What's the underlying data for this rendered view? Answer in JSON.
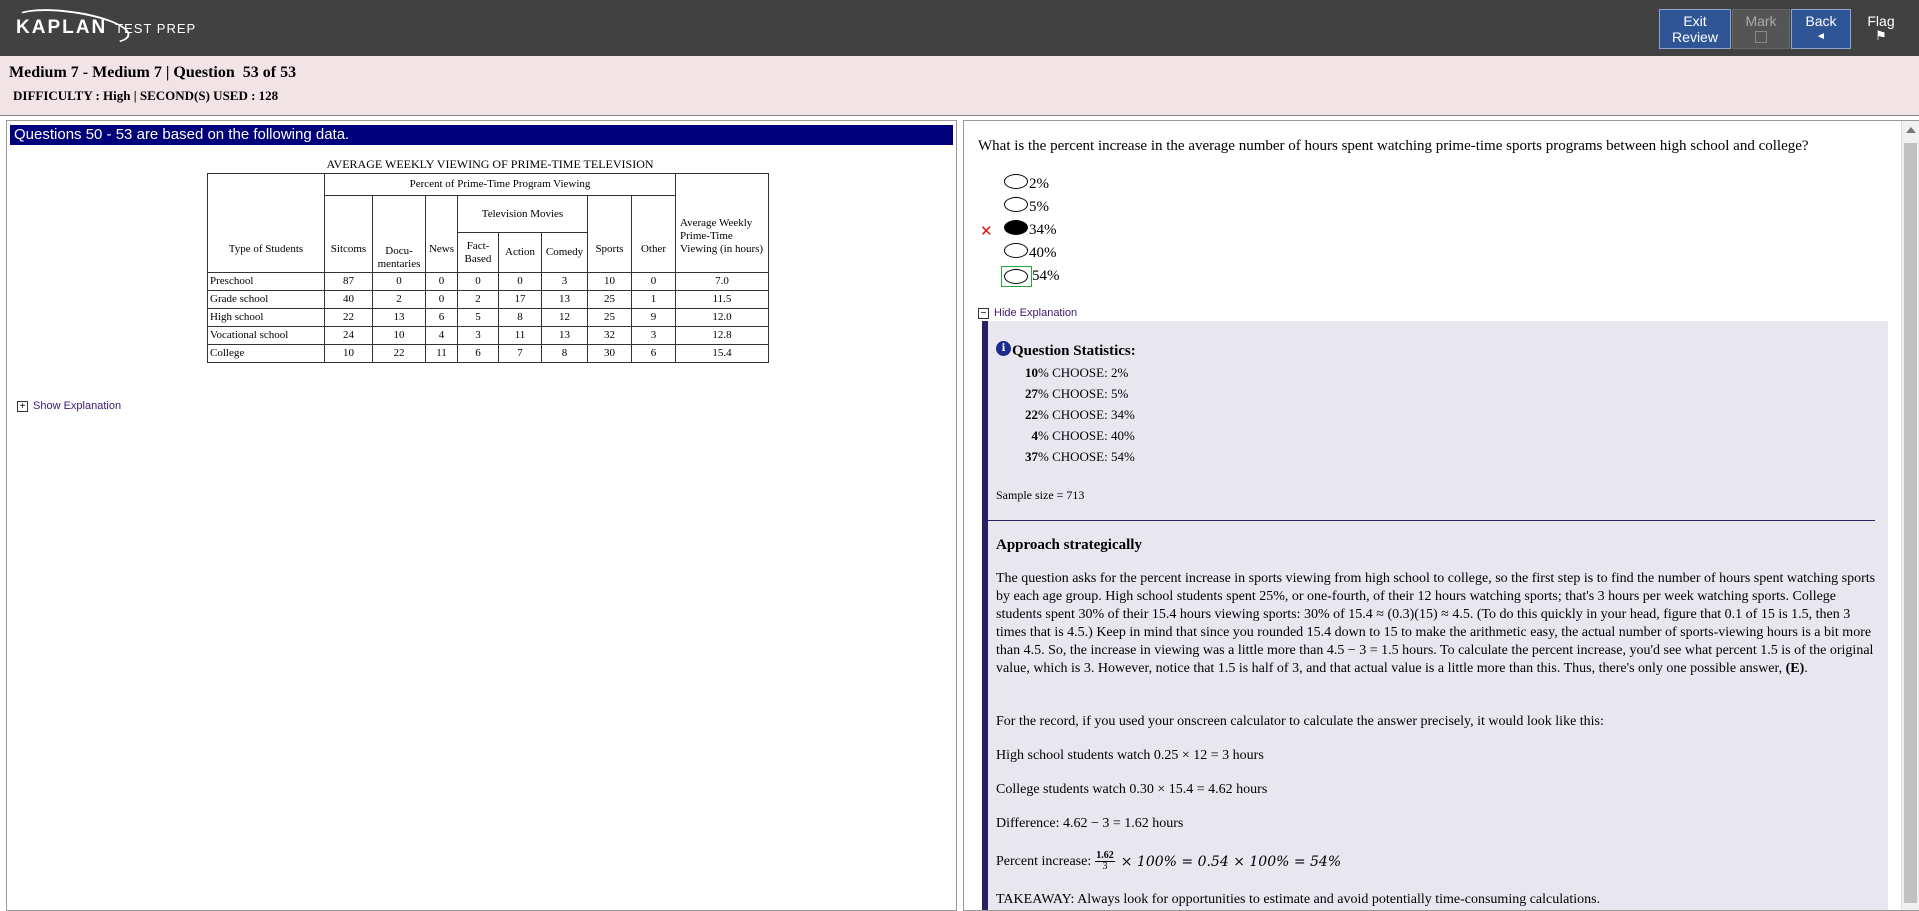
{
  "topbar": {
    "logo_brand": "KAPLAN",
    "logo_sub": "TEST PREP",
    "exit_line1": "Exit",
    "exit_line2": "Review",
    "mark_label": "Mark",
    "back_label": "Back",
    "back_arrow": "◄",
    "flag_label": "Flag",
    "flag_icon": "⚑"
  },
  "header": {
    "title": "Medium 7 - Medium 7 | Question  53 of 53",
    "difficulty": "DIFFICULTY : High | SECOND(S) USED : 128"
  },
  "passage": {
    "banner": "Questions 50 - 53 are based on the following data.",
    "table_title": "AVERAGE WEEKLY VIEWING OF PRIME-TIME TELEVISION",
    "group_header": "Percent of Prime-Time Program Viewing",
    "tv_movies_header": "Television Movies",
    "type_header": "Type of Students",
    "avg_header": "Average Weekly Prime-Time Viewing (in hours)",
    "columns": {
      "sitcoms": "Sitcoms",
      "documentaries": "Docu- mentaries",
      "news": "News",
      "fact_based": "Fact- Based",
      "action": "Action",
      "comedy": "Comedy",
      "sports": "Sports",
      "other": "Other"
    },
    "rows": [
      [
        "Preschool",
        "87",
        "0",
        "0",
        "0",
        "0",
        "3",
        "10",
        "0",
        "7.0"
      ],
      [
        "Grade school",
        "40",
        "2",
        "0",
        "2",
        "17",
        "13",
        "25",
        "1",
        "11.5"
      ],
      [
        "High school",
        "22",
        "13",
        "6",
        "5",
        "8",
        "12",
        "25",
        "9",
        "12.0"
      ],
      [
        "Vocational school",
        "24",
        "10",
        "4",
        "3",
        "11",
        "13",
        "32",
        "3",
        "12.8"
      ],
      [
        "College",
        "10",
        "22",
        "11",
        "6",
        "7",
        "8",
        "30",
        "6",
        "15.4"
      ]
    ],
    "show_explanation": "Show Explanation"
  },
  "question": {
    "text": "What is the percent increase in the average number of hours spent watching prime-time sports programs between high school and college?",
    "choices": [
      "2%",
      "5%",
      "34%",
      "40%",
      "54%"
    ],
    "selected_index": 2,
    "correct_index": 4,
    "wrong_mark": "✕",
    "hide_explanation": "Hide Explanation"
  },
  "explanation": {
    "stats_title": "Question Statistics:",
    "stats": [
      {
        "pct": "10",
        "label": "% CHOOSE: 2%"
      },
      {
        "pct": "27",
        "label": "% CHOOSE: 5%"
      },
      {
        "pct": "22",
        "label": "% CHOOSE: 34%"
      },
      {
        "pct": "4",
        "label": "% CHOOSE: 40%"
      },
      {
        "pct": "37",
        "label": "% CHOOSE: 54%"
      }
    ],
    "sample_size": "Sample size = 713",
    "approach_title": "Approach strategically",
    "para1": "The question asks for the percent increase in sports viewing from high school to college, so the first step is to find the number of hours spent watching sports by each age group. High school students spent 25%, or one-fourth, of their 12 hours watching sports; that's 3 hours per week watching sports. College students spent 30% of their 15.4 hours viewing sports: 30% of 15.4 ≈ (0.3)(15) ≈ 4.5. (To do this quickly in your head, figure that 0.1 of 15 is 1.5, then 3 times that is 4.5.) Keep in mind that since you rounded 15.4 down to 15 to make the arithmetic easy, the actual number of sports-viewing hours is a bit more than 4.5. So, the increase in viewing was a little more than 4.5 − 3 = 1.5 hours. To calculate the percent increase, you'd see what percent 1.5 is of the original value, which is 3. However, notice that 1.5 is half of 3, and that actual value is a little more than this. Thus, there's only one possible answer,",
    "para1_answer": "(E)",
    "para2": "For the record, if you used your onscreen calculator to calculate the answer precisely, it would look like this:",
    "para3": "High school students watch 0.25 × 12 = 3 hours",
    "para4": "College students watch 0.30 × 15.4 = 4.62 hours",
    "para5": "Difference: 4.62 − 3 = 1.62 hours",
    "para6_label": "Percent increase:",
    "frac_num": "1.62",
    "frac_den": "3",
    "para6_math": "× 100% = 0.54 × 100% = 54%",
    "takeaway": "TAKEAWAY: Always look for opportunities to estimate and avoid potentially time-consuming calculations."
  }
}
